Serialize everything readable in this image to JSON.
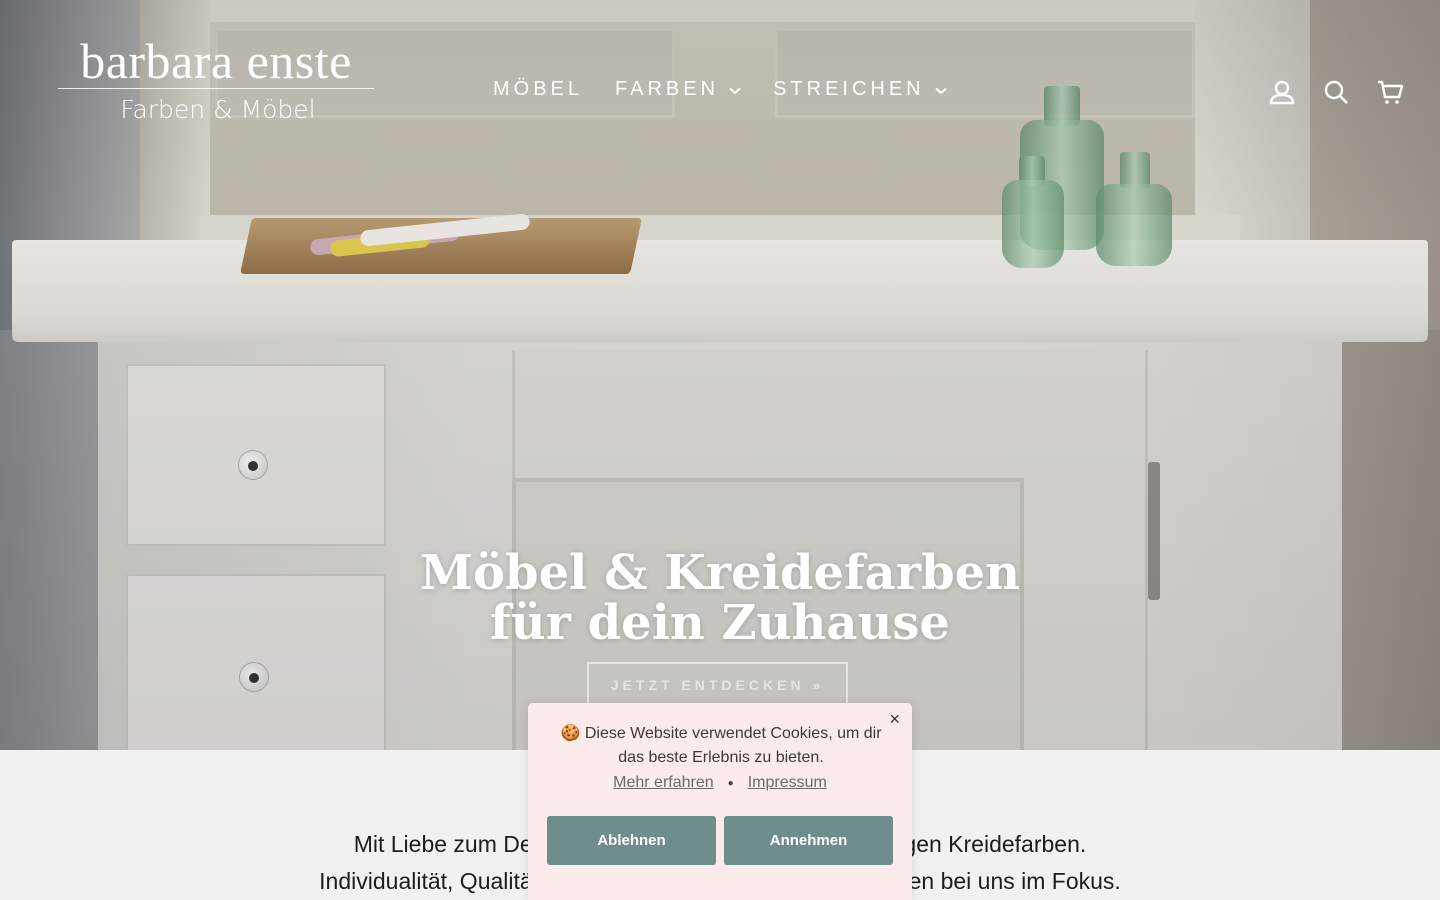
{
  "brand": {
    "name": "barbara enste",
    "tagline": "Farben & Möbel"
  },
  "nav": {
    "items": [
      {
        "label": "MÖBEL",
        "has_dropdown": false
      },
      {
        "label": "FARBEN",
        "has_dropdown": true
      },
      {
        "label": "STREICHEN",
        "has_dropdown": true
      }
    ],
    "icons": [
      "account-icon",
      "search-icon",
      "cart-icon"
    ]
  },
  "hero": {
    "title_line1": "Möbel & Kreidefarben",
    "title_line2": "für dein Zuhause",
    "cta_label": "JETZT ENTDECKEN »"
  },
  "intro": {
    "line1": "Mit Liebe zum Detail restaurierte Möbel und hochwertigen Kreidefarben.",
    "line2": "Individualität, Qualität und fachkundige Farbberatung stehen bei uns im Fokus."
  },
  "cookie": {
    "close_label": "×",
    "icon": "🍪",
    "message": "Diese Website verwendet Cookies, um dir das beste Erlebnis zu bieten.",
    "link_more": "Mehr erfahren",
    "link_imprint": "Impressum",
    "separator": "●",
    "decline_label": "Ablehnen",
    "accept_label": "Annehmen"
  },
  "colors": {
    "cookie_bg": "#fbeceb",
    "button_bg": "#6f8d8c",
    "page_bg": "#f1f1ef"
  }
}
